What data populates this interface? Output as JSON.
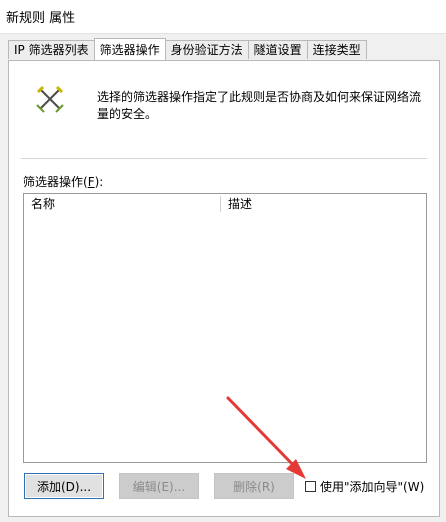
{
  "window": {
    "title": "新规则 属性"
  },
  "tabs": [
    {
      "label": "IP 筛选器列表",
      "active": false
    },
    {
      "label": "筛选器操作",
      "active": true
    },
    {
      "label": "身份验证方法",
      "active": false
    },
    {
      "label": "隧道设置",
      "active": false
    },
    {
      "label": "连接类型",
      "active": false
    }
  ],
  "description": "选择的筛选器操作指定了此规则是否协商及如何来保证网络流量的安全。",
  "list": {
    "label_prefix": "筛选器操作(",
    "label_key": "F",
    "label_suffix": "):",
    "columns": [
      "名称",
      "描述"
    ],
    "rows": []
  },
  "buttons": {
    "add": "添加(D)...",
    "edit": "编辑(E)...",
    "remove": "删除(R)"
  },
  "wizard_checkbox": {
    "label": "使用\"添加向导\"(W)",
    "checked": false
  },
  "colors": {
    "annotation_arrow": "#e53935",
    "focus_border": "#2f6fb5"
  }
}
